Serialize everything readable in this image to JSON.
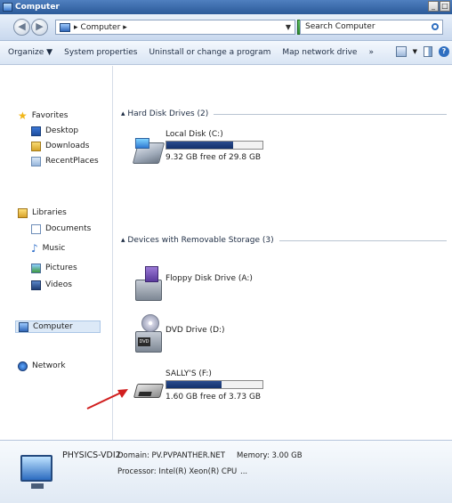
{
  "window": {
    "title": "Computer"
  },
  "address": {
    "crumb": "Computer",
    "search_placeholder": "Search Computer"
  },
  "toolbar": {
    "organize": "Organize ▼",
    "system_properties": "System properties",
    "uninstall": "Uninstall or change a program",
    "map_drive": "Map network drive",
    "more": "»"
  },
  "nav": {
    "favorites": "Favorites",
    "desktop": "Desktop",
    "downloads": "Downloads",
    "recent": "RecentPlaces",
    "libraries": "Libraries",
    "documents": "Documents",
    "music": "Music",
    "pictures": "Pictures",
    "videos": "Videos",
    "computer": "Computer",
    "network": "Network"
  },
  "groups": {
    "hdd": "Hard Disk Drives (2)",
    "removable": "Devices with Removable Storage (3)"
  },
  "drives": {
    "c": {
      "name": "Local Disk (C:)",
      "free": "9.32 GB free of 29.8 GB",
      "used_fraction": 0.69
    },
    "a": {
      "name": "Floppy Disk Drive (A:)"
    },
    "d": {
      "name": "DVD Drive (D:)"
    },
    "f": {
      "name": "SALLY'S (F:)",
      "free": "1.60 GB free of 3.73 GB",
      "used_fraction": 0.57
    }
  },
  "details": {
    "computer_name": "PHYSICS-VDI2",
    "domain": "Domain: PV.PVPANTHER.NET",
    "memory": "Memory: 3.00 GB",
    "processor": "Processor: Intel(R) Xeon(R) CPU",
    "ellipsis": "..."
  },
  "colors": {
    "arrow": "#d11f1f",
    "bar_fill": "#1a3a7a",
    "selection": "#dce9f7"
  }
}
